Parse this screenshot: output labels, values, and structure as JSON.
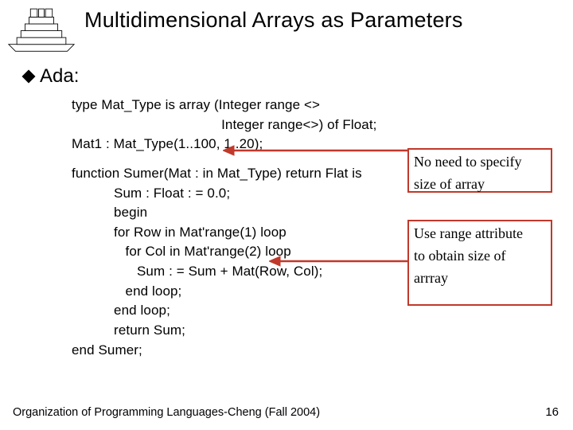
{
  "title": "Multidimensional Arrays as Parameters",
  "bullet": "Ada:",
  "code": {
    "l1": "type Mat_Type is array (Integer range <>",
    "l2": "                                       Integer range<>) of Float;",
    "l3": "Mat1 : Mat_Type(1..100, 1..20);",
    "l4": "function Sumer(Mat : in Mat_Type) return Flat is",
    "l5": "           Sum : Float : = 0.0;",
    "l6": "           begin",
    "l7": "           for Row in Mat'range(1) loop",
    "l8": "              for Col in Mat'range(2) loop",
    "l9": "                 Sum : = Sum + Mat(Row, Col);",
    "l10": "              end loop;",
    "l11": "           end loop;",
    "l12": "           return Sum;",
    "l13": "end Sumer;"
  },
  "note1_a": "No need to specify",
  "note1_b": "size of array",
  "note2_a": "Use range attribute",
  "note2_b": "to obtain size of",
  "note2_c": "arrray",
  "footer": "Organization of Programming Languages-Cheng (Fall 2004)",
  "pagenum": "16",
  "logo_labels": {
    "t1": "",
    "t2": "",
    "t3": "",
    "t4": "",
    "t5": ""
  }
}
